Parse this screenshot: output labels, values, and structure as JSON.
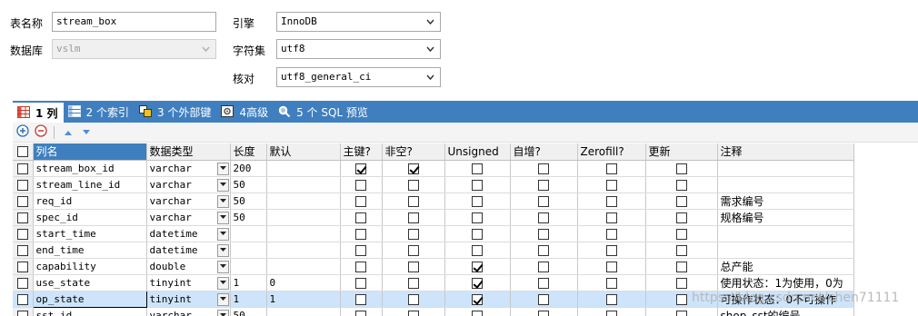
{
  "form": {
    "table_name_label": "表名称",
    "table_name_value": "stream_box",
    "database_label": "数据库",
    "database_value": "vslm",
    "engine_label": "引擎",
    "engine_value": "InnoDB",
    "charset_label": "字符集",
    "charset_value": "utf8",
    "collation_label": "核对",
    "collation_value": "utf8_general_ci"
  },
  "tabs": [
    {
      "label": "1 列",
      "icon": "columns-icon",
      "active": true
    },
    {
      "label": "2 个索引",
      "icon": "index-icon",
      "active": false
    },
    {
      "label": "3 个外部键",
      "icon": "foreign-key-icon",
      "active": false
    },
    {
      "label": "4高级",
      "icon": "advanced-icon",
      "active": false
    },
    {
      "label": "5 个 SQL 预览",
      "icon": "sql-preview-icon",
      "active": false
    }
  ],
  "toolbar": {
    "add_icon": "add-circle-icon",
    "remove_icon": "remove-circle-icon",
    "up_icon": "move-up-icon",
    "down_icon": "move-down-icon"
  },
  "grid": {
    "headers": {
      "name": "列名",
      "type": "数据类型",
      "length": "长度",
      "default": "默认",
      "pk": "主键?",
      "not_null": "非空?",
      "unsigned": "Unsigned",
      "auto_inc": "自增?",
      "zerofill": "Zerofill?",
      "update": "更新",
      "comment": "注释"
    },
    "rows": [
      {
        "name": "stream_box_id",
        "type": "varchar",
        "length": "200",
        "default": "",
        "pk": true,
        "not_null": true,
        "unsigned": false,
        "auto_inc": false,
        "zerofill": false,
        "update": false,
        "comment": ""
      },
      {
        "name": "stream_line_id",
        "type": "varchar",
        "length": "50",
        "default": "",
        "pk": false,
        "not_null": false,
        "unsigned": false,
        "auto_inc": false,
        "zerofill": false,
        "update": false,
        "comment": ""
      },
      {
        "name": "req_id",
        "type": "varchar",
        "length": "50",
        "default": "",
        "pk": false,
        "not_null": false,
        "unsigned": false,
        "auto_inc": false,
        "zerofill": false,
        "update": false,
        "comment": "需求编号"
      },
      {
        "name": "spec_id",
        "type": "varchar",
        "length": "50",
        "default": "",
        "pk": false,
        "not_null": false,
        "unsigned": false,
        "auto_inc": false,
        "zerofill": false,
        "update": false,
        "comment": "规格编号"
      },
      {
        "name": "start_time",
        "type": "datetime",
        "length": "",
        "default": "",
        "pk": false,
        "not_null": false,
        "unsigned": false,
        "auto_inc": false,
        "zerofill": false,
        "update": false,
        "comment": ""
      },
      {
        "name": "end_time",
        "type": "datetime",
        "length": "",
        "default": "",
        "pk": false,
        "not_null": false,
        "unsigned": false,
        "auto_inc": false,
        "zerofill": false,
        "update": false,
        "comment": ""
      },
      {
        "name": "capability",
        "type": "double",
        "length": "",
        "default": "",
        "pk": false,
        "not_null": false,
        "unsigned": true,
        "auto_inc": false,
        "zerofill": false,
        "update": false,
        "comment": "总产能"
      },
      {
        "name": "use_state",
        "type": "tinyint",
        "length": "1",
        "default": "0",
        "pk": false,
        "not_null": false,
        "unsigned": true,
        "auto_inc": false,
        "zerofill": false,
        "update": false,
        "comment": "使用状态：1为使用，0为"
      },
      {
        "name": "op_state",
        "type": "tinyint",
        "length": "1",
        "default": "1",
        "pk": false,
        "not_null": false,
        "unsigned": true,
        "auto_inc": false,
        "zerofill": false,
        "update": false,
        "comment": "可操作状态：0不可操作",
        "selected": true
      },
      {
        "name": "sst_id",
        "type": "varchar",
        "length": "50",
        "default": "",
        "pk": false,
        "not_null": false,
        "unsigned": false,
        "auto_inc": false,
        "zerofill": false,
        "update": false,
        "comment": "shop_sst的编号"
      }
    ]
  },
  "watermark": "https://blog.csdn.net/chen71111"
}
